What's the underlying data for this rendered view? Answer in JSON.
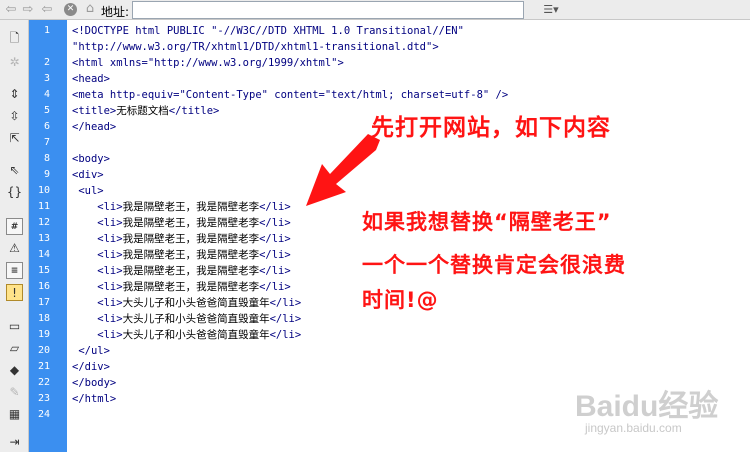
{
  "toolbar": {
    "back_icon": "back-arrow-icon",
    "forward_icon": "forward-arrow-icon",
    "stop_icon": "stop-icon",
    "home_icon": "home-icon",
    "address_label": "地址:",
    "address_value": ""
  },
  "sidebar": {
    "icons": [
      "open-documents-icon",
      "show-code-navigator-icon",
      "collapse-full-tag-icon",
      "collapse-selection-icon",
      "expand-all-icon",
      "select-parent-tag-icon",
      "balance-braces-icon",
      "line-numbers-icon",
      "highlight-invalid-code-icon",
      "word-wrap-icon",
      "syntax-error-alerts-icon",
      "apply-comment-icon",
      "remove-comment-icon",
      "wrap-tag-icon",
      "recent-snippets-icon",
      "move-css-icon",
      "indent-code-icon"
    ]
  },
  "editor": {
    "line_numbers": [
      "1",
      "",
      "2",
      "3",
      "4",
      "5",
      "6",
      "7",
      "8",
      "9",
      "10",
      "11",
      "12",
      "13",
      "14",
      "15",
      "16",
      "17",
      "18",
      "19",
      "20",
      "21",
      "22",
      "23",
      "24"
    ],
    "lines": [
      {
        "tag_open": "<!DOCTYPE html PUBLIC \"-//W3C//DTD XHTML 1.0 Transitional//EN\"",
        "text": "",
        "tag_close": ""
      },
      {
        "tag_open": "\"http://www.w3.org/TR/xhtml1/DTD/xhtml1-transitional.dtd\">",
        "text": "",
        "tag_close": ""
      },
      {
        "tag_open": "<html xmlns=\"http://www.w3.org/1999/xhtml\">",
        "text": "",
        "tag_close": ""
      },
      {
        "tag_open": "<head>",
        "text": "",
        "tag_close": ""
      },
      {
        "tag_open": "<meta http-equiv=\"Content-Type\" content=\"text/html; charset=utf-8\" />",
        "text": "",
        "tag_close": ""
      },
      {
        "tag_open": "<title>",
        "text": "无标题文档",
        "tag_close": "</title>"
      },
      {
        "tag_open": "</head>",
        "text": "",
        "tag_close": ""
      },
      {
        "tag_open": "",
        "text": "",
        "tag_close": ""
      },
      {
        "tag_open": "<body>",
        "text": "",
        "tag_close": ""
      },
      {
        "tag_open": "<div>",
        "text": "",
        "tag_close": ""
      },
      {
        "tag_open": " <ul>",
        "text": "",
        "tag_close": ""
      },
      {
        "tag_open": "    <li>",
        "text": "我是隔壁老王，我是隔壁老李",
        "tag_close": "</li>"
      },
      {
        "tag_open": "    <li>",
        "text": "我是隔壁老王，我是隔壁老李",
        "tag_close": "</li>"
      },
      {
        "tag_open": "    <li>",
        "text": "我是隔壁老王，我是隔壁老李",
        "tag_close": "</li>"
      },
      {
        "tag_open": "    <li>",
        "text": "我是隔壁老王，我是隔壁老李",
        "tag_close": "</li>"
      },
      {
        "tag_open": "    <li>",
        "text": "我是隔壁老王，我是隔壁老李",
        "tag_close": "</li>"
      },
      {
        "tag_open": "    <li>",
        "text": "我是隔壁老王，我是隔壁老李",
        "tag_close": "</li>"
      },
      {
        "tag_open": "    <li>",
        "text": "大头儿子和小头爸爸简直毁童年",
        "tag_close": "</li>"
      },
      {
        "tag_open": "    <li>",
        "text": "大头儿子和小头爸爸简直毁童年",
        "tag_close": "</li>"
      },
      {
        "tag_open": "    <li>",
        "text": "大头儿子和小头爸爸简直毁童年",
        "tag_close": "</li>"
      },
      {
        "tag_open": " </ul>",
        "text": "",
        "tag_close": ""
      },
      {
        "tag_open": "</div>",
        "text": "",
        "tag_close": ""
      },
      {
        "tag_open": "</body>",
        "text": "",
        "tag_close": ""
      },
      {
        "tag_open": "</html>",
        "text": "",
        "tag_close": ""
      },
      {
        "tag_open": "",
        "text": "",
        "tag_close": ""
      }
    ]
  },
  "annotations": {
    "line1": "先打开网站，如下内容",
    "line2": "如果我想替换“隔壁老王”",
    "line3": "一个一个替换肯定会很浪费",
    "line4": "时间!@",
    "arrow_icon": "red-arrow-icon"
  },
  "watermark": {
    "brand": "Baidu经验",
    "sub": "jingyan.baidu.com"
  },
  "colors": {
    "gutter": "#3b8ff0",
    "tag_text": "#000080",
    "annotation": "#ff1414"
  }
}
